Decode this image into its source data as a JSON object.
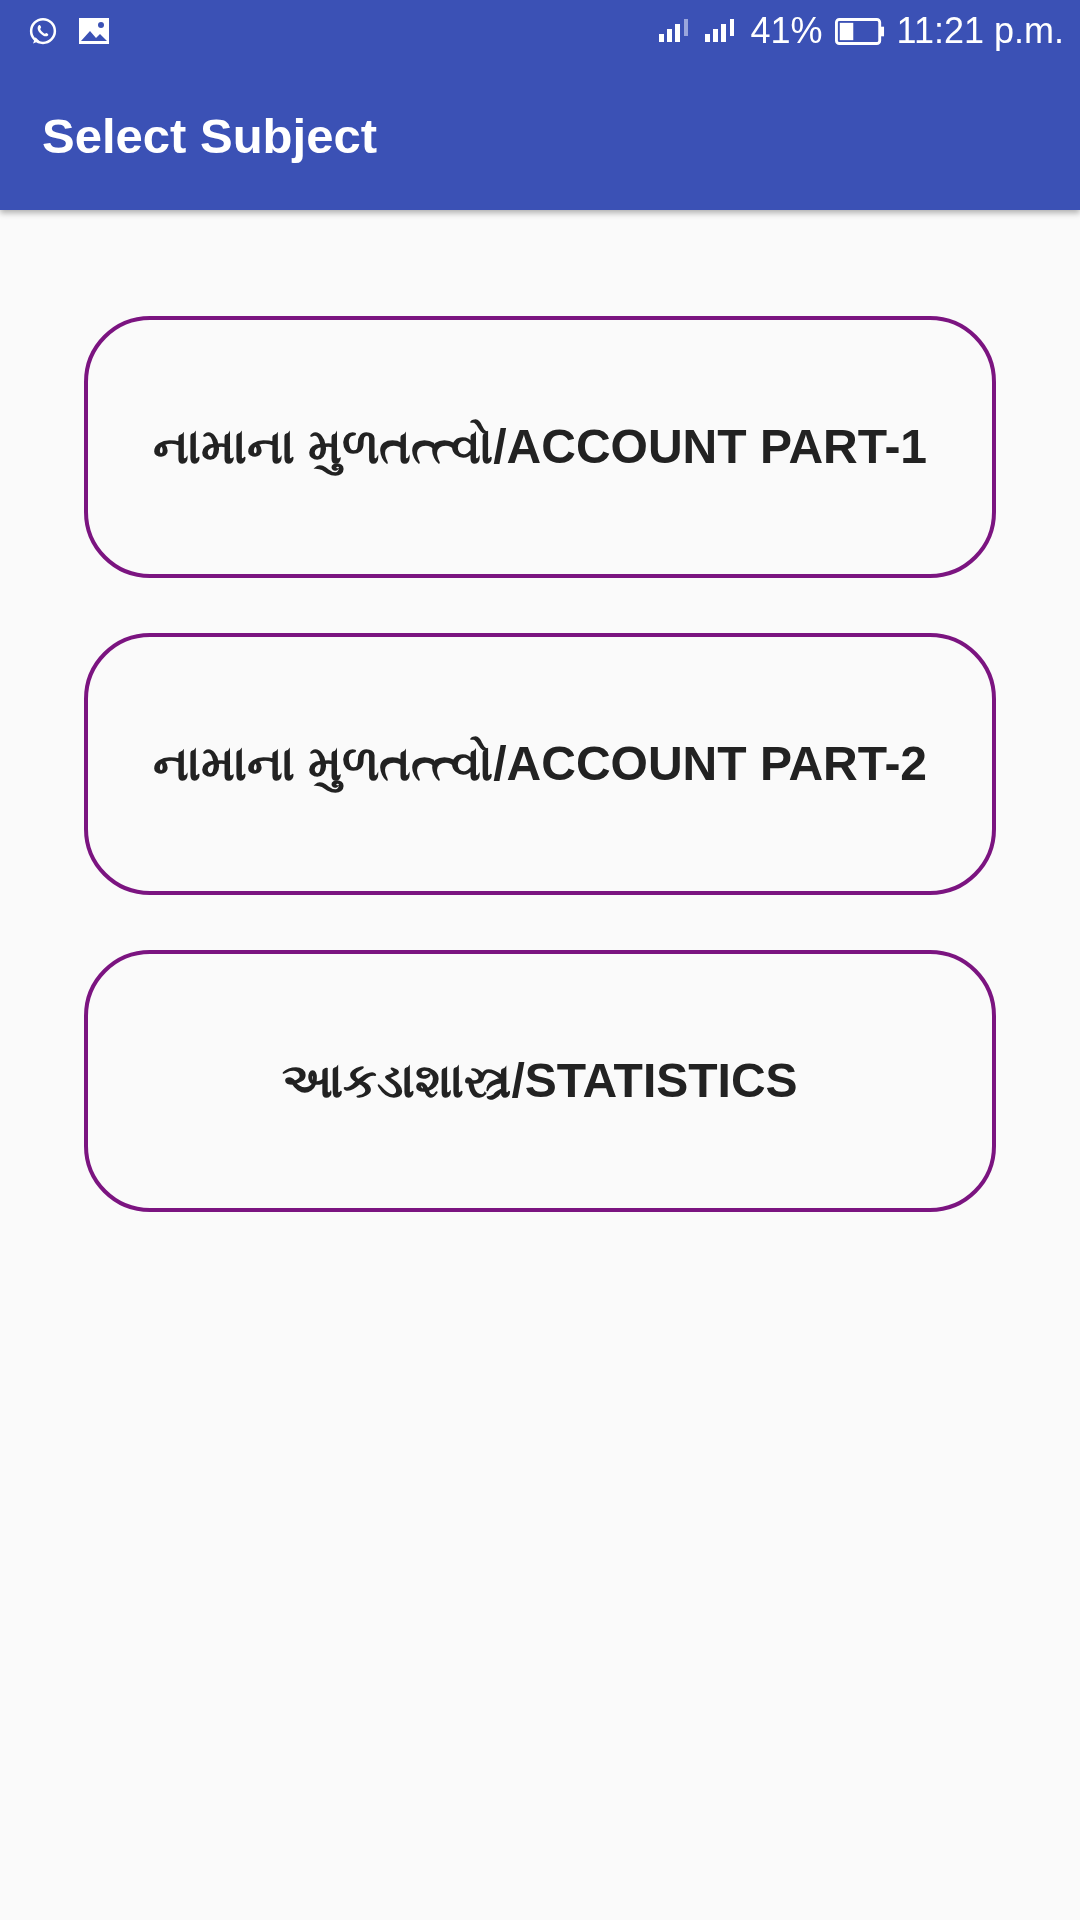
{
  "status_bar": {
    "battery": "41%",
    "time": "11:21 p.m."
  },
  "app_bar": {
    "title": "Select Subject"
  },
  "subjects": [
    {
      "label": "નામાના મુળતત્ત્વો/ACCOUNT PART-1"
    },
    {
      "label": "નામાના મુળતત્ત્વો/ACCOUNT PART-2"
    },
    {
      "label": "આકડાશાસ્ત્ર/STATISTICS"
    }
  ]
}
